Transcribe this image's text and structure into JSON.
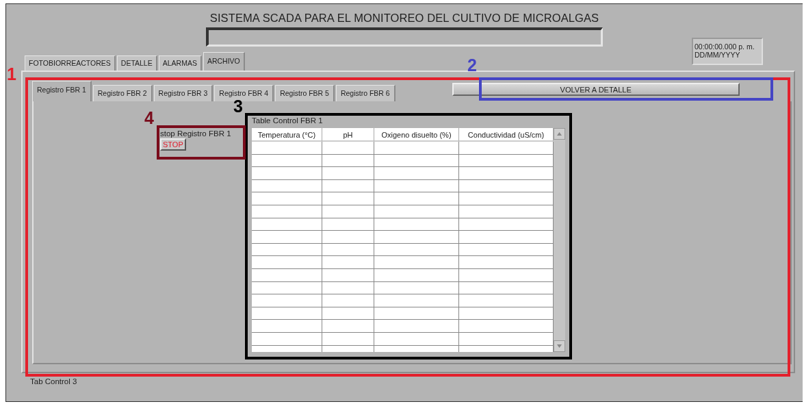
{
  "title": "SISTEMA SCADA PARA EL MONITOREO DEL CULTIVO DE MICROALGAS",
  "clock": {
    "time": "00:00:00.000 p. m.",
    "date": "DD/MM/YYYY"
  },
  "tabs": [
    {
      "label": "FOTOBIORREACTORES",
      "selected": false
    },
    {
      "label": "DETALLE",
      "selected": false
    },
    {
      "label": "ALARMAS",
      "selected": false
    },
    {
      "label": "ARCHIVO",
      "selected": true
    }
  ],
  "subtabs": [
    {
      "label": "Registro FBR 1",
      "selected": true
    },
    {
      "label": "Registro FBR 2",
      "selected": false
    },
    {
      "label": "Registro FBR 3",
      "selected": false
    },
    {
      "label": "Registro FBR 4",
      "selected": false
    },
    {
      "label": "Registro FBR 5",
      "selected": false
    },
    {
      "label": "Registro FBR 6",
      "selected": false
    }
  ],
  "back_button": "VOLVER A DETALLE",
  "stop": {
    "label": "stop Registro FBR 1",
    "button": "STOP"
  },
  "table": {
    "label": "Table Control FBR 1",
    "columns": [
      "Temperatura (°C)",
      "pH",
      "Oxigeno disuelto (%)",
      "Conductividad (uS/cm)"
    ]
  },
  "tab_control_label": "Tab Control 3",
  "annotations": [
    {
      "number": "1",
      "color": "#e3202c"
    },
    {
      "number": "2",
      "color": "#4545c4"
    },
    {
      "number": "3",
      "color": "#000000"
    },
    {
      "number": "4",
      "color": "#7a0c1c"
    }
  ]
}
